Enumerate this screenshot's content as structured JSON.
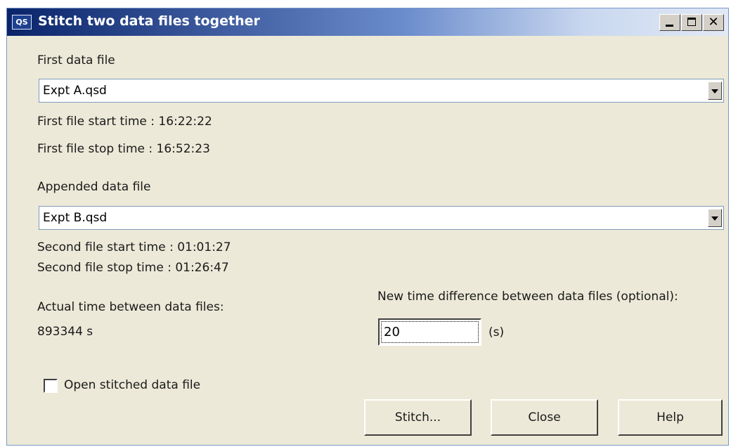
{
  "window": {
    "app_icon_text": "QS",
    "title": "Stitch two data files together"
  },
  "first_file": {
    "label": "First data file",
    "selected": "Expt A.qsd",
    "start_time": "First file start time : 16:22:22",
    "stop_time": "First file stop time : 16:52:23"
  },
  "appended_file": {
    "label": "Appended data file",
    "selected": "Expt B.qsd",
    "start_time": "Second file start time : 01:01:27",
    "stop_time": "Second file stop time : 01:26:47"
  },
  "actual_time": {
    "label": "Actual time between data files:",
    "value": "893344 s"
  },
  "new_time": {
    "label": "New time difference between data files (optional):",
    "value": "20",
    "unit": "(s)"
  },
  "open_stitched": {
    "label": "Open stitched data file",
    "checked": false
  },
  "buttons": {
    "stitch": "Stitch...",
    "close": "Close",
    "help": "Help"
  },
  "colors": {
    "titlebar_start": "#0a246a",
    "titlebar_end": "#e2e9f5",
    "dialog_bg": "#ece9d8"
  },
  "icons": {
    "app": "qs-app-icon",
    "minimize": "minimize-icon",
    "maximize": "maximize-icon",
    "close": "close-icon",
    "dropdown": "chevron-down-icon"
  }
}
